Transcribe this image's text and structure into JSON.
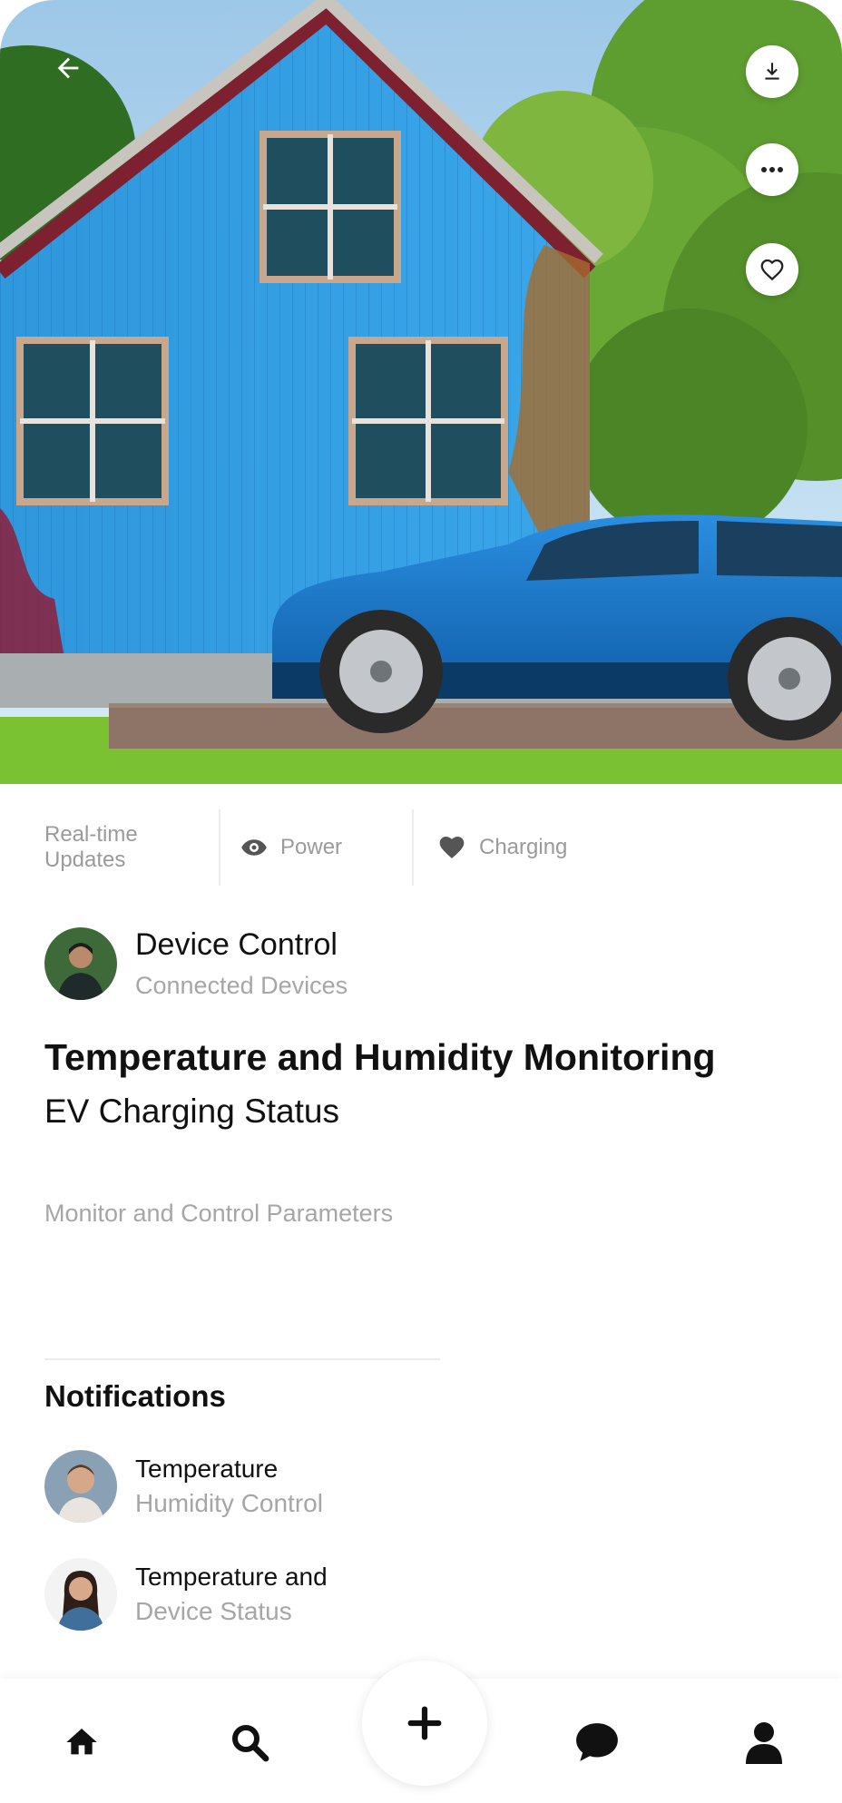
{
  "hero": {
    "back_icon": "arrow-left-icon",
    "actions": [
      {
        "icon": "download-icon"
      },
      {
        "icon": "more-icon"
      },
      {
        "icon": "heart-outline-icon"
      }
    ]
  },
  "stats": [
    {
      "label": "Real-time Updates"
    },
    {
      "label": "Power",
      "icon": "eye-icon"
    },
    {
      "label": "Charging",
      "icon": "heart-icon"
    }
  ],
  "author": {
    "name": "Device Control",
    "subtitle": "Connected Devices"
  },
  "content": {
    "title": "Temperature and Humidity Monitoring",
    "subtitle": "EV Charging Status",
    "description": "Monitor and Control Parameters"
  },
  "notifications": {
    "heading": "Notifications",
    "items": [
      {
        "title": "Temperature",
        "subtitle": "Humidity Control"
      },
      {
        "title": "Temperature and",
        "subtitle": "Device Status"
      }
    ]
  },
  "nav": {
    "items": [
      "home-icon",
      "search-icon",
      "add-icon",
      "chat-icon",
      "profile-icon"
    ]
  }
}
